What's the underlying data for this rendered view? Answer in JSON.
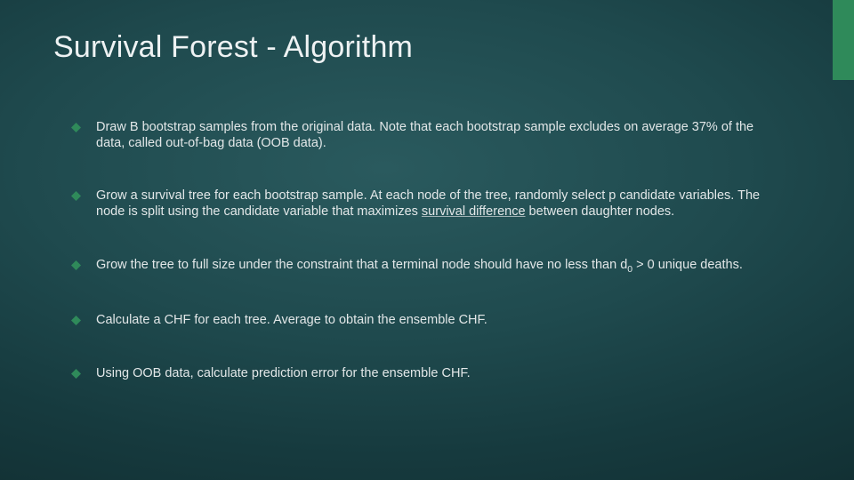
{
  "slide": {
    "title": "Survival Forest - Algorithm",
    "bullets": [
      {
        "pre": "Draw B bootstrap samples from the original data. Note that each bootstrap sample excludes on average 37% of the data, called out-of-bag data (OOB data)."
      },
      {
        "pre": "Grow a survival tree for each bootstrap sample. At each node of the tree, randomly select p candidate variables. The node is split using the candidate variable that maximizes ",
        "link": "survival difference",
        "post": " between daughter nodes."
      },
      {
        "pre": "Grow the tree to full size under the constraint that a terminal node should have no less than d",
        "sub": "0",
        "post2": " > 0 unique deaths."
      },
      {
        "pre": "Calculate a CHF for each tree. Average to obtain the ensemble CHF."
      },
      {
        "pre": "Using OOB data, calculate prediction error for the ensemble CHF."
      }
    ]
  }
}
